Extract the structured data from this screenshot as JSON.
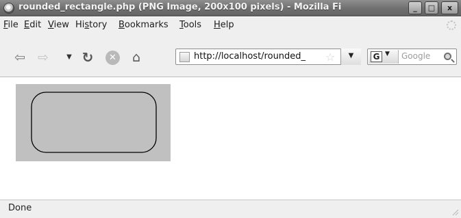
{
  "window": {
    "title": "rounded_rectangle.php (PNG Image, 200x100 pixels) - Mozilla Fi",
    "minimize": "_",
    "maximize": "□",
    "close": "x"
  },
  "menu": {
    "items": [
      {
        "label": "File",
        "key": "F",
        "rest": "ile"
      },
      {
        "label": "Edit",
        "key": "E",
        "rest": "dit"
      },
      {
        "label": "View",
        "key": "V",
        "rest": "iew"
      },
      {
        "label": "History",
        "key": "s",
        "pre": "Hi",
        "rest": "tory"
      },
      {
        "label": "Bookmarks",
        "key": "B",
        "rest": "ookmarks"
      },
      {
        "label": "Tools",
        "key": "T",
        "rest": "ools"
      },
      {
        "label": "Help",
        "key": "H",
        "rest": "elp"
      }
    ]
  },
  "toolbar": {
    "back": "⇦",
    "forward": "⇨",
    "history_dropdown": "▼",
    "reload": "↻",
    "stop": "✕",
    "home": "⌂"
  },
  "urlbar": {
    "url": "http://localhost/rounded_",
    "star": "☆",
    "dropdown": "▼"
  },
  "search": {
    "engine_letter": "G",
    "engine_caret": "▼",
    "placeholder": "Google"
  },
  "content": {
    "image_background": "#c0c0c0",
    "shape_stroke": "#000000"
  },
  "status": {
    "text": "Done"
  }
}
